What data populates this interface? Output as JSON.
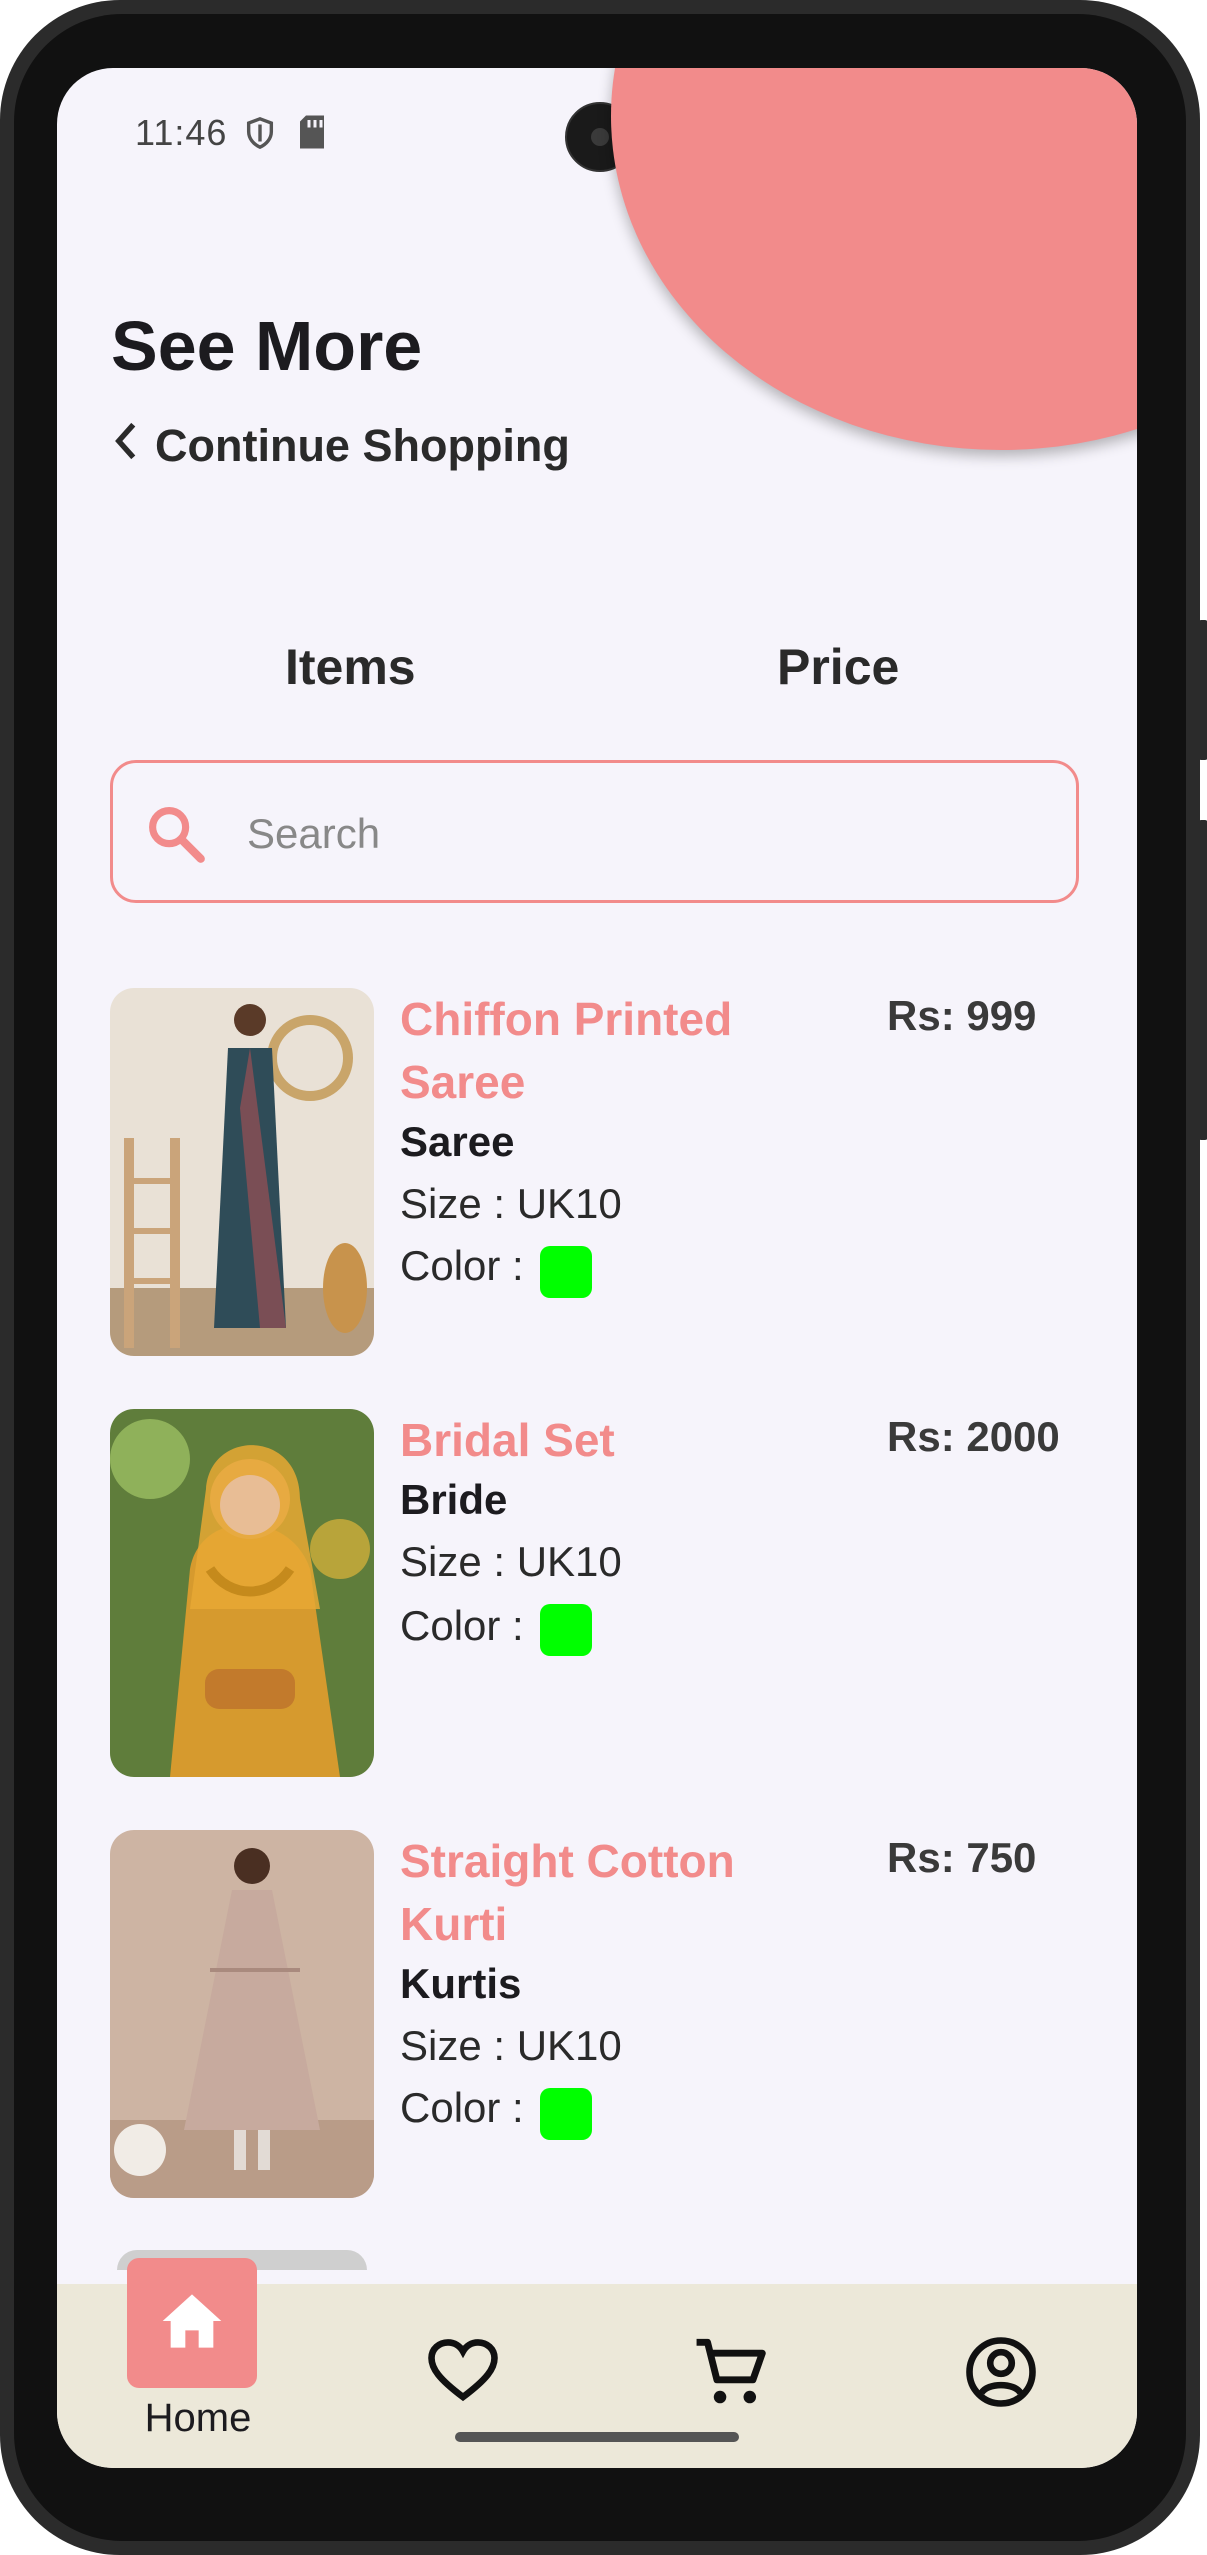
{
  "status_bar": {
    "time": "11:46"
  },
  "header": {
    "title": "See More",
    "back_label": "Continue Shopping"
  },
  "tabs": [
    {
      "label": "Items"
    },
    {
      "label": "Price"
    }
  ],
  "search": {
    "placeholder": "Search",
    "value": ""
  },
  "products": [
    {
      "name": "Chiffon Printed Saree",
      "category": "Saree",
      "size": "Size : UK10",
      "color_label": "Color :",
      "color": "#00ff00",
      "price": "Rs: 999"
    },
    {
      "name": "Bridal  Set",
      "category": "Bride",
      "size": "Size : UK10",
      "color_label": "Color :",
      "color": "#00ff00",
      "price": "Rs: 2000"
    },
    {
      "name": "Straight Cotton Kurti",
      "category": "Kurtis",
      "size": "Size : UK10",
      "color_label": "Color :",
      "color": "#00ff00",
      "price": "Rs: 750"
    }
  ],
  "bottom_nav": {
    "items": [
      {
        "label": "Home",
        "icon": "home-icon"
      },
      {
        "label": "",
        "icon": "heart-icon"
      },
      {
        "label": "",
        "icon": "cart-icon"
      },
      {
        "label": "",
        "icon": "account-icon"
      }
    ]
  },
  "colors": {
    "accent": "#f28b8b",
    "background": "#f6f4fb",
    "nav_background": "#ece8d9"
  }
}
